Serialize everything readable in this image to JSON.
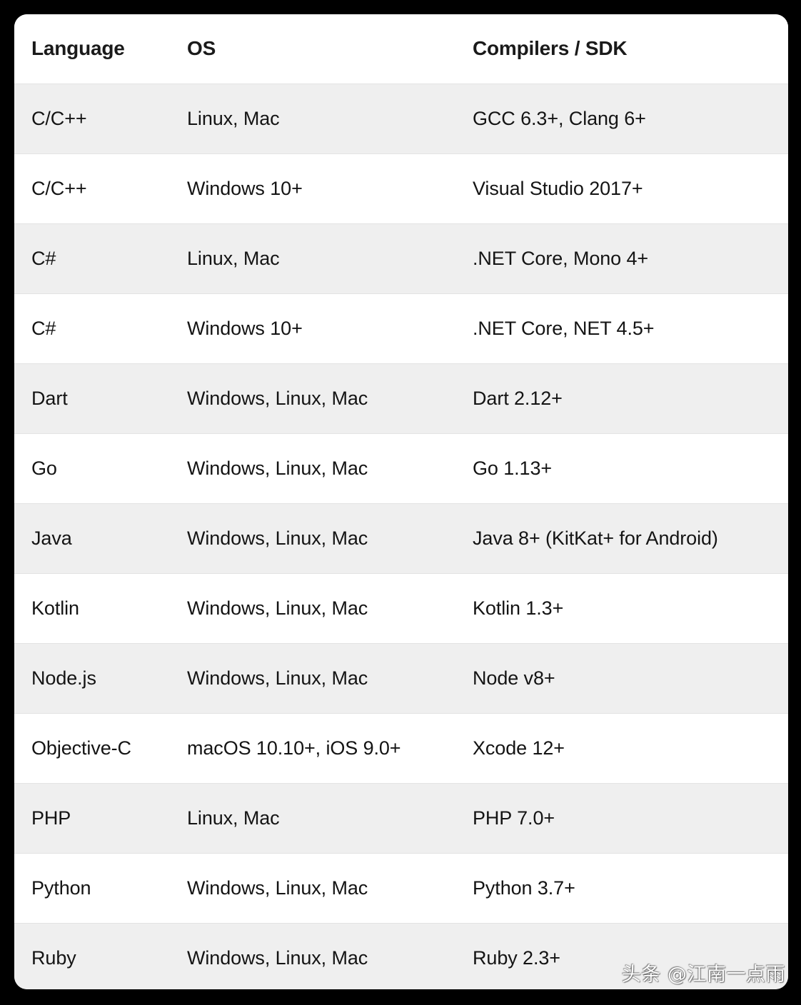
{
  "table": {
    "columns": [
      {
        "key": "language",
        "label": "Language"
      },
      {
        "key": "os",
        "label": "OS"
      },
      {
        "key": "sdk",
        "label": "Compilers / SDK"
      }
    ],
    "rows": [
      {
        "language": "C/C++",
        "os": "Linux, Mac",
        "sdk": "GCC 6.3+, Clang 6+"
      },
      {
        "language": "C/C++",
        "os": "Windows 10+",
        "sdk": "Visual Studio 2017+"
      },
      {
        "language": "C#",
        "os": "Linux, Mac",
        "sdk": ".NET Core, Mono 4+"
      },
      {
        "language": "C#",
        "os": "Windows 10+",
        "sdk": ".NET Core, NET 4.5+"
      },
      {
        "language": "Dart",
        "os": "Windows, Linux, Mac",
        "sdk": "Dart 2.12+"
      },
      {
        "language": "Go",
        "os": "Windows, Linux, Mac",
        "sdk": "Go 1.13+"
      },
      {
        "language": "Java",
        "os": "Windows, Linux, Mac",
        "sdk": "Java 8+ (KitKat+ for Android)"
      },
      {
        "language": "Kotlin",
        "os": "Windows, Linux, Mac",
        "sdk": "Kotlin 1.3+"
      },
      {
        "language": "Node.js",
        "os": "Windows, Linux, Mac",
        "sdk": "Node v8+"
      },
      {
        "language": "Objective-C",
        "os": "macOS 10.10+, iOS 9.0+",
        "sdk": "Xcode 12+"
      },
      {
        "language": "PHP",
        "os": "Linux, Mac",
        "sdk": "PHP 7.0+"
      },
      {
        "language": "Python",
        "os": "Windows, Linux, Mac",
        "sdk": "Python 3.7+"
      },
      {
        "language": "Ruby",
        "os": "Windows, Linux, Mac",
        "sdk": "Ruby 2.3+"
      }
    ]
  },
  "watermark": {
    "text": "头条 @江南一点雨"
  },
  "colors": {
    "page_background": "#000000",
    "card_background": "#ffffff",
    "row_stripe": "#efefef",
    "row_plain": "#ffffff",
    "header_text": "#1a1a1a",
    "body_text": "#141414",
    "row_divider": "#e3e3e3"
  }
}
